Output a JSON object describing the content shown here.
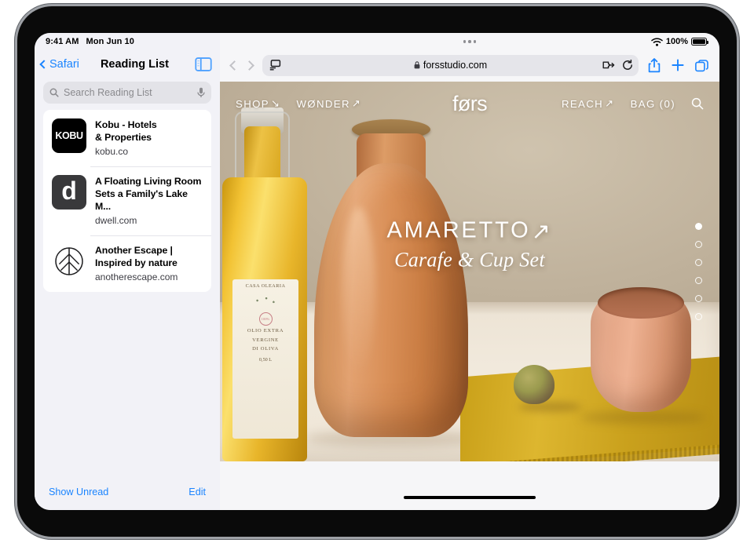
{
  "status_bar": {
    "time": "9:41 AM",
    "date": "Mon Jun 10",
    "battery_percent": "100%",
    "wifi_icon": "wifi-icon",
    "battery_icon": "battery-icon"
  },
  "sidebar": {
    "back_label": "Safari",
    "title": "Reading List",
    "toggle_icon": "sidebar-toggle-icon",
    "search": {
      "placeholder": "Search Reading List",
      "value": "",
      "search_icon": "search-icon",
      "mic_icon": "microphone-icon"
    },
    "items": [
      {
        "favicon_text": "KOBU",
        "favicon_type": "kobu-wordmark",
        "title": "Kobu - Hotels & Properties",
        "title_line1": "Kobu - Hotels",
        "title_line2": "& Properties",
        "domain": "kobu.co"
      },
      {
        "favicon_text": "d",
        "favicon_type": "dwell-letter",
        "title": "A Floating Living Room Sets a Family's Lake M...",
        "title_line1": "A Floating Living Room",
        "title_line2": "Sets a Family's Lake M...",
        "domain": "dwell.com"
      },
      {
        "favicon_text": "",
        "favicon_type": "leaf-circle",
        "title": "Another Escape | Inspired by nature",
        "title_line1": "Another Escape |",
        "title_line2": "Inspired by nature",
        "domain": "anotherescape.com"
      }
    ],
    "footer": {
      "show_unread": "Show Unread",
      "edit": "Edit"
    }
  },
  "browser": {
    "multitask_icon": "multitask-handle-icon",
    "back_icon": "chevron-left-icon",
    "forward_icon": "chevron-right-icon",
    "address_bar": {
      "reader_icon": "reader-view-icon",
      "lock_icon": "lock-icon",
      "url": "forsstudio.com",
      "extensions_icon": "extensions-icon",
      "reload_icon": "reload-icon"
    },
    "actions": {
      "share_icon": "share-icon",
      "new_tab_icon": "plus-icon",
      "tabs_icon": "tab-overview-icon"
    }
  },
  "website": {
    "brand": "førs",
    "nav_left": [
      {
        "label": "SHOP",
        "arrow": "↘"
      },
      {
        "label": "WØNDER",
        "arrow": "↗"
      }
    ],
    "nav_right": [
      {
        "label": "REACH",
        "arrow": "↗"
      },
      {
        "label": "BAG (0)",
        "arrow": ""
      }
    ],
    "search_icon": "search-icon",
    "hero": {
      "title": "AMARETTO",
      "title_arrow": "↗",
      "subtitle": "Carafe & Cup Set"
    },
    "pagination": {
      "total": 6,
      "active_index": 0
    },
    "product_photo": {
      "bottle_label": {
        "brand": "CASA OLEARIA",
        "stamp": "100%",
        "line1": "OLIO EXTRA",
        "line2": "VERGINE",
        "line3": "DI OLIVA",
        "volume": "0,50 L"
      }
    }
  },
  "colors": {
    "ios_blue": "#1a84ff",
    "sidebar_bg": "#f2f2f7",
    "card_bg": "#ffffff",
    "terracotta": "#d08a51",
    "cloth_yellow": "#ddb62f",
    "wall_taupe": "#bfb19b"
  }
}
